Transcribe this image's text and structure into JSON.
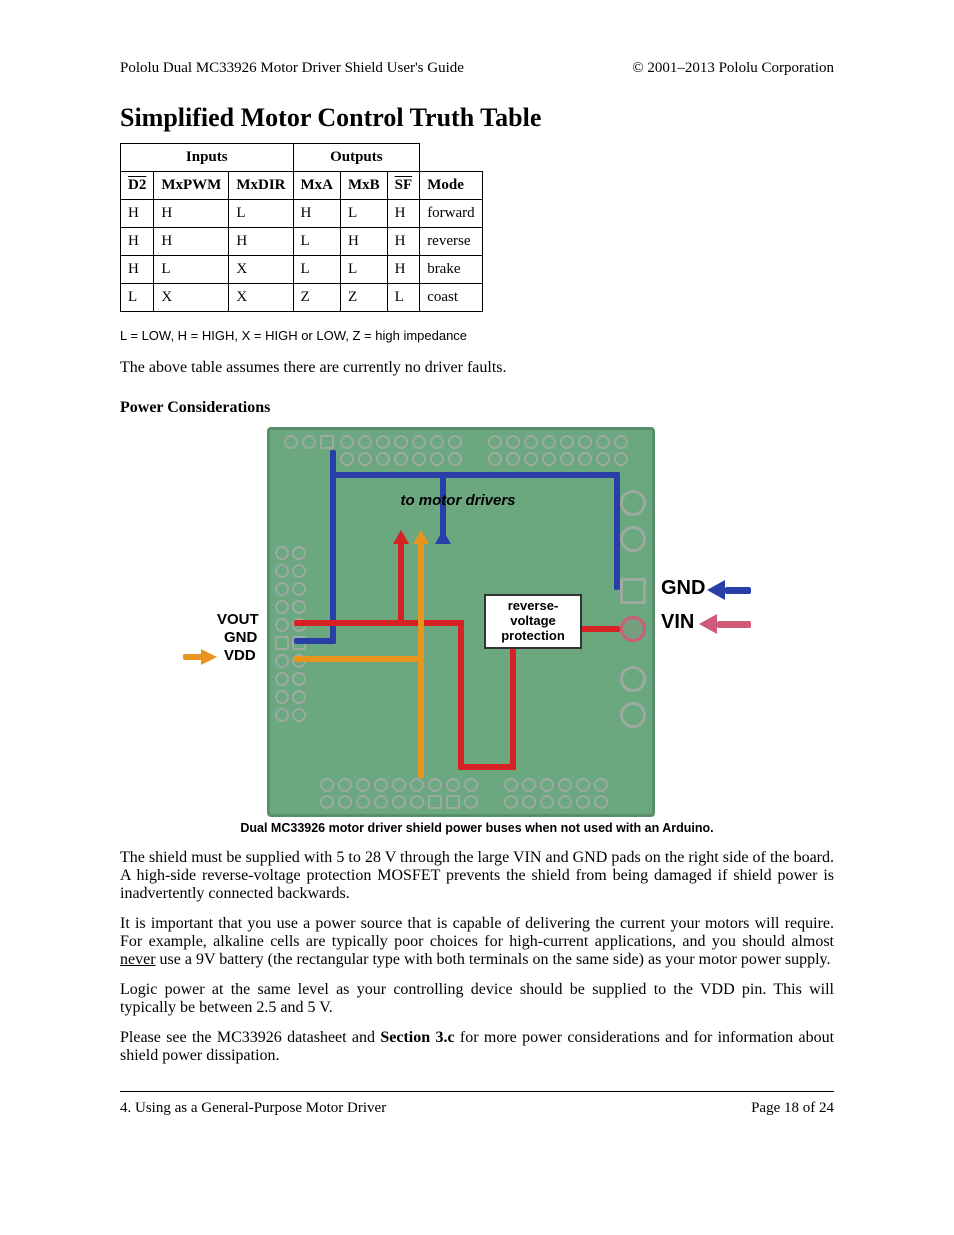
{
  "header": {
    "left": "Pololu Dual MC33926 Motor Driver Shield User's Guide",
    "right": "© 2001–2013 Pololu Corporation"
  },
  "title": "Simplified Motor Control Truth Table",
  "table": {
    "group1": "Inputs",
    "group2": "Outputs",
    "headers": [
      "D2",
      "MxPWM",
      "MxDIR",
      "MxA",
      "MxB",
      "SF",
      "Mode"
    ],
    "rows": [
      [
        "H",
        "H",
        "L",
        "H",
        "L",
        "H",
        "forward"
      ],
      [
        "H",
        "H",
        "H",
        "L",
        "H",
        "H",
        "reverse"
      ],
      [
        "H",
        "L",
        "X",
        "L",
        "L",
        "H",
        "brake"
      ],
      [
        "L",
        "X",
        "X",
        "Z",
        "Z",
        "L",
        "coast"
      ]
    ]
  },
  "legend": "L = LOW, H = HIGH, X = HIGH or LOW, Z = high impedance",
  "paras": {
    "0": "The above table assumes there are currently no driver faults.",
    "1": "The shield must be supplied with 5 to 28 V through the large VIN and GND pads on the right side of the board. A high-side reverse-voltage protection MOSFET prevents the shield from being damaged if shield power is inadvertently connected backwards.",
    "2a": "It is important that you use a power source that is capable of delivering the current your motors will require. For example, alkaline cells are typically poor choices for high-current applications, and you should almost ",
    "2u": "never",
    "2b": " use a 9V battery (the rectangular type with both terminals on the same side) as your motor power supply.",
    "3": "Logic power at the same level as your controlling device should be supplied to the VDD pin. This will typically be between 2.5 and 5 V.",
    "4a": "Please see the MC33926 datasheet and ",
    "4b": "Section 3.c",
    "4c": " for more power considerations and for information about shield power dissipation."
  },
  "subheading": "Power Considerations",
  "figure": {
    "to_motor": "to motor drivers",
    "rvp": "reverse-voltage protection",
    "vout": "VOUT",
    "gnd": "GND",
    "vdd": "VDD",
    "gnd_big": "GND",
    "vin": "VIN",
    "caption": "Dual MC33926 motor driver shield power buses when not used with an Arduino."
  },
  "footer": {
    "left": "4. Using as a General-Purpose Motor Driver",
    "right": "Page 18 of 24"
  }
}
